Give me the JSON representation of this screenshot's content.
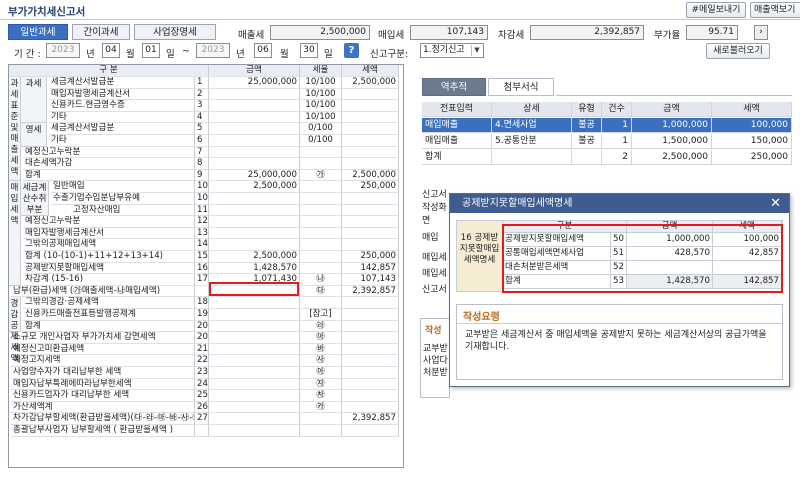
{
  "window": {
    "title": "부가가치세신고서"
  },
  "toolbar": {
    "email_btn": "#메일보내기",
    "print_btn": "매출액보기"
  },
  "tabs": [
    "일반과세",
    "간이과세",
    "사업장명세"
  ],
  "summary": {
    "sales_tax_label": "매출세",
    "sales_tax_value": "2,500,000",
    "purchase_tax_label": "매입세",
    "purchase_tax_value": "107,143",
    "diff_tax_label": "차감세",
    "diff_tax_value": "2,392,857",
    "vat_rate_label": "부가율",
    "vat_rate_value": "95.71",
    "next_icon": "chevron-right-icon"
  },
  "period": {
    "label": "기 간 :",
    "from_year": "2023",
    "year_unit": "년",
    "from_month": "04",
    "month_unit": "월",
    "from_day": "01",
    "day_unit": "일",
    "tilde": "~",
    "to_year": "2023",
    "to_month": "06",
    "to_day": "30",
    "help_icon": "?",
    "report_label": "신고구분:",
    "report_value": "1.정기신고",
    "reload_btn": "새로불러오기"
  },
  "main_table": {
    "headers": [
      "구 분",
      "금액",
      "세율",
      "세액"
    ],
    "group_labels": {
      "output": "과세표준및매출세액",
      "taxable": "과세",
      "zero": "영세",
      "purchase": "매입세액",
      "received": "세금계산수취부분",
      "deduct": "경감공제세액"
    },
    "rows": [
      {
        "label": "세금계산서발급분",
        "no": "1",
        "amount": "25,000,000",
        "rate": "10/100",
        "tax": "2,500,000"
      },
      {
        "label": "매입자발행세금계산서",
        "no": "2",
        "amount": "",
        "rate": "10/100",
        "tax": ""
      },
      {
        "label": "신용카드.현금영수증",
        "no": "3",
        "amount": "",
        "rate": "10/100",
        "tax": ""
      },
      {
        "label": "기타",
        "no": "4",
        "amount": "",
        "rate": "10/100",
        "tax": ""
      },
      {
        "label": "세금계산서발급분",
        "no": "5",
        "amount": "",
        "rate": "0/100",
        "tax": ""
      },
      {
        "label": "기타",
        "no": "6",
        "amount": "",
        "rate": "0/100",
        "tax": ""
      },
      {
        "label": "예정신고누락분",
        "no": "7",
        "amount": "",
        "rate": "",
        "tax": ""
      },
      {
        "label": "대손세액가감",
        "no": "8",
        "amount": "",
        "rate": "",
        "tax": ""
      },
      {
        "label": "합계",
        "no": "9",
        "amount": "25,000,000",
        "rate": "㉮",
        "tax": "2,500,000"
      },
      {
        "label": "일반매입",
        "no": "10",
        "amount": "2,500,000",
        "rate": "",
        "tax": "250,000"
      },
      {
        "label": "수출기업수입분납부유예",
        "no": "10-1",
        "amount": "",
        "rate": "",
        "tax": ""
      },
      {
        "label": "고정자산매입",
        "no": "11",
        "amount": "",
        "rate": "",
        "tax": ""
      },
      {
        "label": "예정신고누락분",
        "no": "12",
        "amount": "",
        "rate": "",
        "tax": ""
      },
      {
        "label": "매입자발행세금계산서",
        "no": "13",
        "amount": "",
        "rate": "",
        "tax": ""
      },
      {
        "label": "그밖의공제매입세액",
        "no": "14",
        "amount": "",
        "rate": "",
        "tax": ""
      },
      {
        "label": "합계 (10-(10-1)+11+12+13+14)",
        "no": "15",
        "amount": "2,500,000",
        "rate": "",
        "tax": "250,000"
      },
      {
        "label": "공제받지못할매입세액",
        "no": "16",
        "amount": "1,428,570",
        "rate": "",
        "tax": "142,857"
      },
      {
        "label": "차감계 (15-16)",
        "no": "17",
        "amount": "1,071,430",
        "rate": "㉯",
        "tax": "107,143"
      },
      {
        "label": "납부(환급)세액 (㉮매출세액-㉯매입세액)",
        "no": "",
        "amount": "",
        "rate": "㉰",
        "tax": "2,392,857"
      },
      {
        "label": "그밖의경감·공제세액",
        "no": "18",
        "amount": "",
        "rate": "",
        "tax": ""
      },
      {
        "label": "신용카드매출전표등발행공제계",
        "no": "19",
        "amount": "",
        "rate": "[참고]",
        "tax": ""
      },
      {
        "label": "합계",
        "no": "20",
        "amount": "",
        "rate": "㉱",
        "tax": ""
      },
      {
        "label": "소규모 개인사업자 부가가치세 감면세액",
        "no": "20-1",
        "amount": "",
        "rate": "㉲",
        "tax": ""
      },
      {
        "label": "예정신고미환급세액",
        "no": "21",
        "amount": "",
        "rate": "㉳",
        "tax": ""
      },
      {
        "label": "예정고지세액",
        "no": "22",
        "amount": "",
        "rate": "㉴",
        "tax": ""
      },
      {
        "label": "사업양수자가 대리납부한 세액",
        "no": "23",
        "amount": "",
        "rate": "㉵",
        "tax": ""
      },
      {
        "label": "매입자납부특례에따라납부한세액",
        "no": "24",
        "amount": "",
        "rate": "㉶",
        "tax": ""
      },
      {
        "label": "신용카드업자가 대리납부한 세액",
        "no": "25",
        "amount": "",
        "rate": "㉷",
        "tax": ""
      },
      {
        "label": "가산세액계",
        "no": "26",
        "amount": "",
        "rate": "㉸",
        "tax": ""
      },
      {
        "label": "차가감납부할세액(환급받을세액)(㉰-㉱-㉲-㉳-㉴-㉵-㉶-㉷+㉸)",
        "no": "27",
        "amount": "",
        "rate": "",
        "tax": "2,392,857"
      },
      {
        "label": "총괄납부사업자 납부할세액 ( 환급받을세액 )",
        "no": "",
        "amount": "",
        "rate": "",
        "tax": ""
      }
    ]
  },
  "right_tabs": [
    "역추적",
    "첨부서식"
  ],
  "right_table": {
    "headers": [
      "전표입력",
      "상세",
      "유형",
      "건수",
      "금액",
      "세액"
    ],
    "rows": [
      {
        "entry": "매입매출",
        "detail": "4.면세사업",
        "type": "불공",
        "count": "1",
        "amount": "1,000,000",
        "tax": "100,000"
      },
      {
        "entry": "매입매출",
        "detail": "5.공통안분",
        "type": "불공",
        "count": "1",
        "amount": "1,500,000",
        "tax": "150,000"
      },
      {
        "entry": "합계",
        "detail": "",
        "type": "",
        "count": "2",
        "amount": "2,500,000",
        "tax": "250,000"
      }
    ],
    "below_fragments": [
      "신고서작성화면",
      "매입",
      "매입세",
      "매입세",
      "신고서"
    ],
    "partial_lower": [
      "작성",
      "교부받",
      "사업다",
      "처분받"
    ]
  },
  "modal": {
    "title": "공제받지못할매입세액명세",
    "close_icon": "✕",
    "side_label": "16 공제받지못할매입세액명세",
    "headers": [
      "구분",
      "금액",
      "세액"
    ],
    "rows": [
      {
        "label": "공제받지못할매입세액",
        "no": "50",
        "amount": "1,000,000",
        "tax": "100,000"
      },
      {
        "label": "공통매입세액면세사업",
        "no": "51",
        "amount": "428,570",
        "tax": "42,857"
      },
      {
        "label": "대손처분받은세액",
        "no": "52",
        "amount": "",
        "tax": ""
      },
      {
        "label": "합계",
        "no": "53",
        "amount": "1,428,570",
        "tax": "142,857"
      }
    ],
    "guide_title": "작성요령",
    "guide_text": "교부받은 세금계산서 중 매입세액을 공제받지 못하는 세금계산서상의 공급가액을 기재합니다."
  }
}
